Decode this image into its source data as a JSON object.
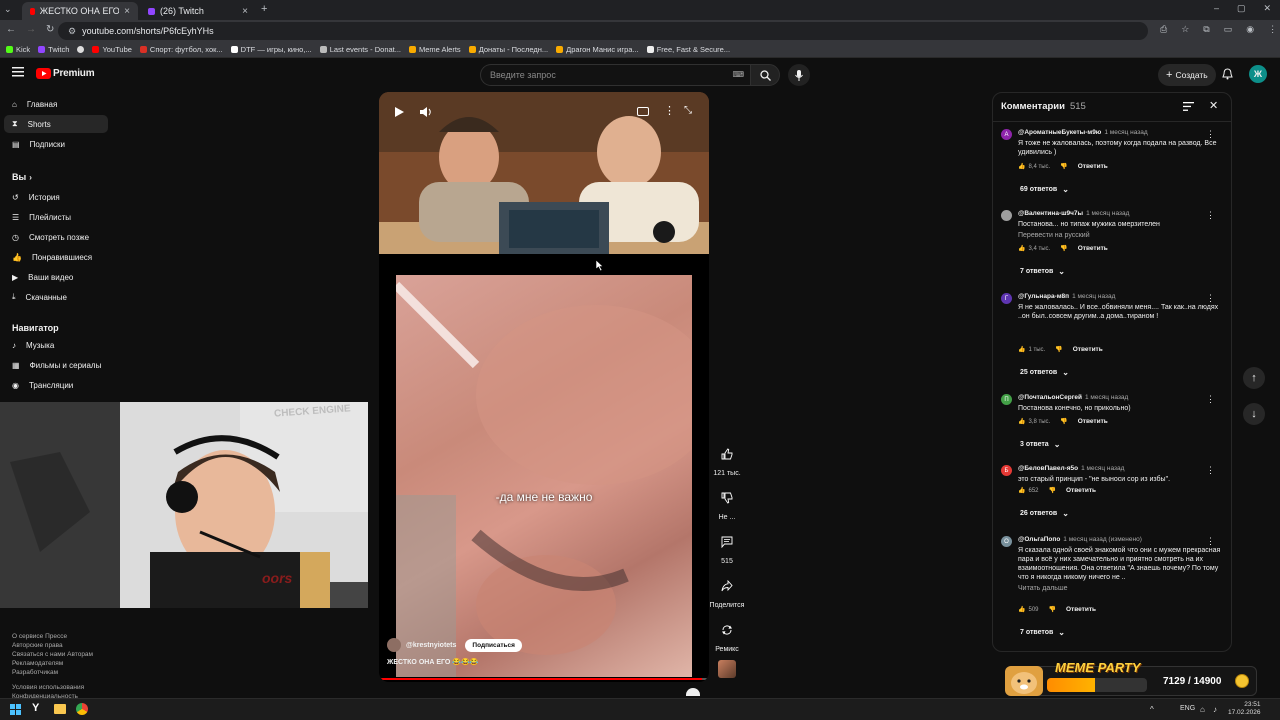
{
  "browser": {
    "tabs": [
      {
        "title": "ЖЕСТКО ОНА ЕГО 😂😂😂",
        "active": true
      },
      {
        "title": "(26) Twitch",
        "active": false
      }
    ],
    "url": "youtube.com/shorts/P6fcEyhYHs",
    "bookmarks": [
      "Kick",
      "Twitch",
      "YouTube",
      "Спорт: футбол, хок...",
      "DTF — игры, кино,...",
      "Last events - Donat...",
      "Meme Alerts",
      "Донаты - Последн...",
      "Драгон Манис игра...",
      "Free, Fast & Secure..."
    ]
  },
  "header": {
    "logo": "Premium",
    "search_placeholder": "Введите запрос",
    "create_label": "Создать",
    "avatar_letter": "Ж"
  },
  "sidebar": {
    "main": [
      {
        "label": "Главная",
        "icon": "home-icon"
      },
      {
        "label": "Shorts",
        "icon": "shorts-icon",
        "active": true
      },
      {
        "label": "Подписки",
        "icon": "subscriptions-icon"
      }
    ],
    "you_heading": "Вы",
    "you": [
      {
        "label": "История",
        "icon": "history-icon"
      },
      {
        "label": "Плейлисты",
        "icon": "playlist-icon"
      },
      {
        "label": "Смотреть позже",
        "icon": "clock-icon"
      },
      {
        "label": "Понравившиеся",
        "icon": "like-icon"
      },
      {
        "label": "Ваши видео",
        "icon": "video-icon"
      },
      {
        "label": "Скачанные",
        "icon": "download-icon"
      }
    ],
    "nav_heading": "Навигатор",
    "nav": [
      {
        "label": "Музыка",
        "icon": "music-icon"
      },
      {
        "label": "Фильмы и сериалы",
        "icon": "movies-icon"
      },
      {
        "label": "Трансляции",
        "icon": "live-icon"
      }
    ],
    "footer": [
      "О сервисе  Прессе",
      "Авторские права",
      "Связаться с нами  Авторам",
      "Рекламодателям",
      "Разработчикам",
      "",
      "Условия использования",
      "Конфиденциальность"
    ]
  },
  "webcam": {
    "sign": "CHECK ENGINE",
    "box_text": "oors"
  },
  "short": {
    "subtitle": "-да мне не важно",
    "channel": "@krestnyiotets",
    "subscribe_label": "Подписаться",
    "title": "ЖЕСТКО ОНА ЕГО 😂😂😂",
    "progress": 0.98
  },
  "actions": [
    {
      "icon": "like-icon",
      "label": "121 тыс."
    },
    {
      "icon": "dislike-icon",
      "label": "Не ..."
    },
    {
      "icon": "comment-icon",
      "label": "515"
    },
    {
      "icon": "share-icon",
      "label": "Поделится"
    },
    {
      "icon": "remix-icon",
      "label": "Ремикс"
    }
  ],
  "comments": {
    "title": "Комментарии",
    "count": "515",
    "items": [
      {
        "author": "@АроматныеБукеты-м9ю",
        "time": "1 месяц назад",
        "text": "Я тоже не жаловалась, поэтому когда подала на развод. Все удивились )",
        "likes": "8,4 тыс.",
        "replies": "69 ответов",
        "color": "#8e24aa",
        "letter": "А"
      },
      {
        "author": "@Валентина-ш9ч7ы",
        "time": "1 месяц назад",
        "text": "Постанова... но типаж мужика омерзителен",
        "sub": "Перевести на русский",
        "likes": "3,4 тыс.",
        "replies": "7 ответов",
        "color": "#9e9e9e",
        "letter": ""
      },
      {
        "author": "@Гульнара-м8п",
        "time": "1 месяц назад",
        "text": "Я не жаловалась.. И все..обвиняли меня.... Так как..на людях ..он был..совсем другим..а дома..тираном !",
        "likes": "1 тыс.",
        "replies": "25 ответов",
        "color": "#5e35b1",
        "letter": "Г"
      },
      {
        "author": "@ПочтальонСергей",
        "time": "1 месяц назад",
        "text": "Постанова конечно, но прикольно)",
        "likes": "3,8 тыс.",
        "replies": "3 ответа",
        "color": "#43a047",
        "letter": "П"
      },
      {
        "author": "@БеловПавел-я5о",
        "time": "1 месяц назад",
        "text": "это старый принцип - \"не выноси сор из избы\".",
        "likes": "652",
        "replies": "26 ответов",
        "color": "#e53935",
        "letter": "Б"
      },
      {
        "author": "@ОльгаПопо",
        "time": "1 месяц назад (изменено)",
        "text": "Я сказала одной своей знакомой что они с мужем прекрасная пара и всё у них замечательно и приятно смотреть на их взаимоотношения. Она ответила \"А знаешь почему? По тому что я никогда никому ничего не ..",
        "sub": "Читать дальше",
        "likes": "509",
        "replies": "7 ответов",
        "color": "#78909c",
        "letter": "О"
      }
    ],
    "reply_label": "Ответить"
  },
  "meme_party": {
    "label": "MEME PARTY",
    "progress_text": "7129 / 14900",
    "progress": 0.478
  },
  "taskbar": {
    "lang": "ENG",
    "time": "23:51",
    "date": "17.02.2026"
  }
}
